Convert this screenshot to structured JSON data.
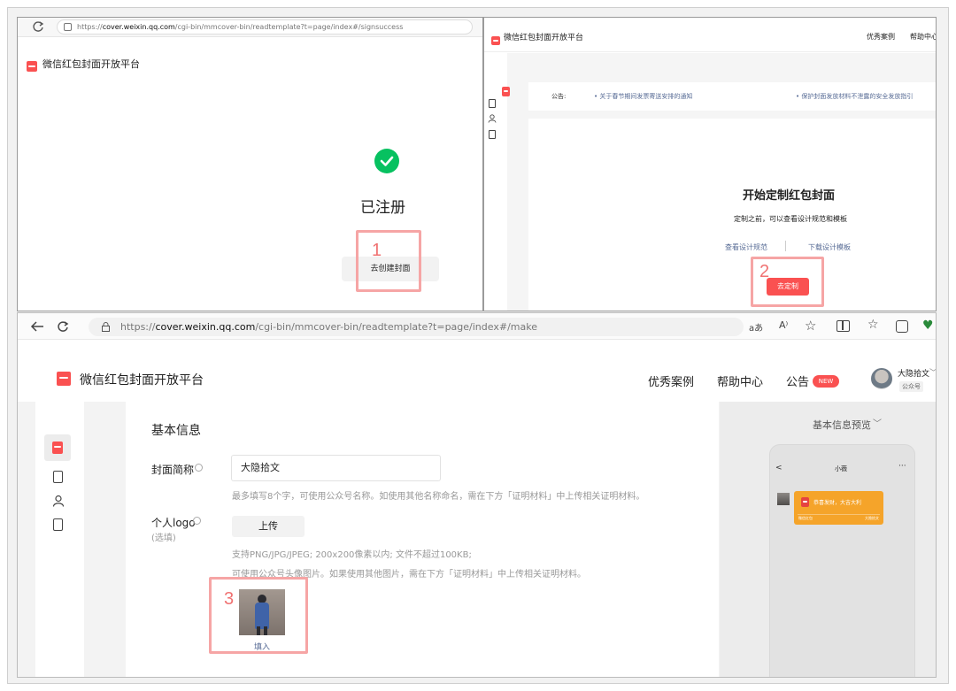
{
  "colors": {
    "brand_red": "#fa5151",
    "check_green": "#07c160",
    "highlight": "#f6a5a5",
    "link_blue": "#576b95",
    "preview_orange": "#f5a42a"
  },
  "panel1": {
    "url": "https://cover.weixin.qq.com/cgi-bin/mmcover-bin/readtemplate?t=page/index#/signsuccess",
    "url_host": "cover.weixin.qq.com",
    "url_prefix": "https://",
    "url_path": "/cgi-bin/mmcover-bin/readtemplate?t=page/index#/signsuccess",
    "platform_name": "微信红包封面开放平台",
    "status_title": "已注册",
    "create_button": "去创建封面",
    "step_number": "1"
  },
  "panel2": {
    "platform_name": "微信红包封面开放平台",
    "nav": [
      "优秀案例",
      "帮助中心"
    ],
    "notice_label": "公告:",
    "notices": [
      "• 关于春节期间发票寄送安排的通知",
      "• 保护封面发放材料不泄露的安全发放指引"
    ],
    "main_title": "开始定制红包封面",
    "subtitle": "定制之前，可以查看设计规范和模板",
    "link_spec": "查看设计规范",
    "link_template": "下载设计模板",
    "customize_button": "去定制",
    "step_number": "2"
  },
  "panel3": {
    "url_prefix": "https://",
    "url_host": "cover.weixin.qq.com",
    "url_path": "/cgi-bin/mmcover-bin/readtemplate?t=page/index#/make",
    "toolbar_text_icon": "aあ",
    "toolbar_read_icon": "A⁾",
    "platform_name": "微信红包封面开放平台",
    "nav": {
      "cases": "优秀案例",
      "help": "帮助中心",
      "notice": "公告",
      "new_badge": "NEW"
    },
    "user": {
      "name": "大隐拾文",
      "type": "公众号"
    },
    "section_title": "基本信息",
    "field_name_label": "封面简称",
    "field_name_value": "大隐拾文",
    "field_name_hint": "最多填写8个字，可使用公众号名称。如使用其他名称命名，需在下方「证明材料」中上传相关证明材料。",
    "field_logo_label": "个人logo",
    "field_logo_optional": "(选填)",
    "upload_button": "上传",
    "logo_hint_1": "支持PNG/JPG/JPEG; 200x200像素以内; 文件不超过100KB;",
    "logo_hint_2": "可使用公众号头像图片。如果使用其他图片，需在下方「证明材料」中上传相关证明材料。",
    "fill_link": "填入",
    "step_number": "3",
    "preview_title": "基本信息预览",
    "phone": {
      "back": "<",
      "name": "小薇",
      "more": "···",
      "bubble_text": "恭喜发财，大吉大利",
      "bubble_footer_left": "微信红包",
      "bubble_footer_right": "大隐拾文"
    }
  }
}
